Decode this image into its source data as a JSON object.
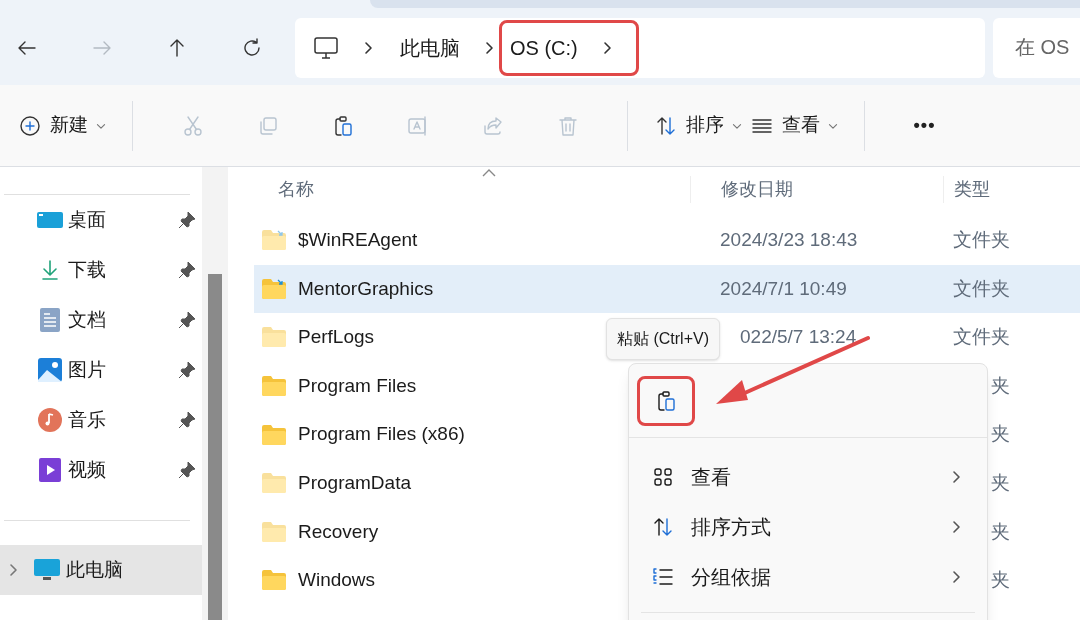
{
  "nav": [
    {
      "kind": "back",
      "disabled": false
    },
    {
      "kind": "forward",
      "disabled": true
    },
    {
      "kind": "up",
      "disabled": false
    },
    {
      "kind": "refresh",
      "disabled": false
    }
  ],
  "breadcrumb": [
    {
      "label": "此电脑",
      "highlighted": false
    },
    {
      "label": "OS (C:)",
      "highlighted": true
    }
  ],
  "search": {
    "placeholder": "在 OS"
  },
  "toolbar": [
    {
      "kind": "new",
      "label": "新建",
      "disabled": false
    },
    {
      "kind": "cut",
      "disabled": true
    },
    {
      "kind": "copy",
      "disabled": true
    },
    {
      "kind": "paste",
      "disabled": false
    },
    {
      "kind": "rename",
      "disabled": true
    },
    {
      "kind": "share",
      "disabled": true
    },
    {
      "kind": "delete",
      "disabled": true
    },
    {
      "kind": "sort",
      "label": "排序",
      "disabled": false
    },
    {
      "kind": "view",
      "label": "查看",
      "disabled": false
    },
    {
      "kind": "more",
      "label": "•••",
      "disabled": false
    }
  ],
  "sidebar": {
    "quick_access": [
      {
        "kind": "desktop",
        "label": "桌面",
        "pinned": true
      },
      {
        "kind": "downloads",
        "label": "下载",
        "pinned": true
      },
      {
        "kind": "documents",
        "label": "文档",
        "pinned": true
      },
      {
        "kind": "pictures",
        "label": "图片",
        "pinned": true
      },
      {
        "kind": "music",
        "label": "音乐",
        "pinned": true
      },
      {
        "kind": "videos",
        "label": "视频",
        "pinned": true
      }
    ],
    "tree": [
      {
        "label": "此电脑",
        "selected": true,
        "expanded": false
      }
    ]
  },
  "table": {
    "columns": [
      "名称",
      "修改日期",
      "类型"
    ],
    "rows": [
      {
        "name": "$WinREAgent",
        "date": "2024/3/23 18:43",
        "type": "文件夹",
        "selected": false,
        "hidden": true,
        "synced": true
      },
      {
        "name": "MentorGraphics",
        "date": "2024/7/1 10:49",
        "type": "文件夹",
        "selected": true,
        "hidden": false,
        "synced": true
      },
      {
        "name": "PerfLogs",
        "date": "022/5/7 13:24",
        "type": "文件夹",
        "selected": false,
        "hidden": true,
        "synced": false
      },
      {
        "name": "Program Files",
        "type": "夹",
        "selected": false,
        "hidden": false,
        "synced": false
      },
      {
        "name": "Program Files (x86)",
        "type": "夹",
        "selected": false,
        "hidden": false,
        "synced": false
      },
      {
        "name": "ProgramData",
        "type": "夹",
        "selected": false,
        "hidden": true,
        "synced": false
      },
      {
        "name": "Recovery",
        "type": "夹",
        "selected": false,
        "hidden": true,
        "synced": false
      },
      {
        "name": "Windows",
        "type": "夹",
        "selected": false,
        "hidden": false,
        "synced": false
      }
    ]
  },
  "tooltip": "粘贴 (Ctrl+V)",
  "context_menu": {
    "quick_actions": [
      {
        "kind": "paste",
        "highlighted": true
      }
    ],
    "items": [
      {
        "kind": "view",
        "label": "查看",
        "submenu": true
      },
      {
        "kind": "sort",
        "label": "排序方式",
        "submenu": true
      },
      {
        "kind": "group",
        "label": "分组依据",
        "submenu": true
      }
    ]
  }
}
